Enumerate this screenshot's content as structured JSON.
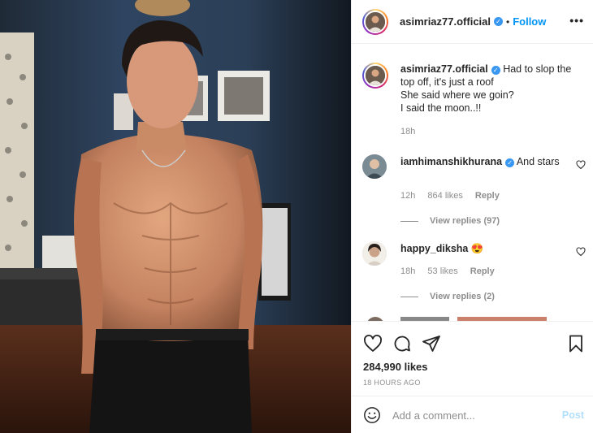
{
  "post": {
    "username": "asimriaz77.official",
    "verified": true,
    "follow_label": "Follow",
    "separator": "•",
    "more_label": "•••",
    "photo_alt": "Shirtless man posing in dim room with framed pictures on blue wall"
  },
  "caption": {
    "username": "asimriaz77.official",
    "lines": [
      "Had to slop the top off, it's just a roof",
      "She said where we goin?",
      "I said the moon..!!"
    ],
    "text": "Had to slop the top off, it's just a roof",
    "line2": "She said where we goin?",
    "line3": "I said the moon..!!",
    "time": "18h"
  },
  "comments": [
    {
      "username": "iamhimanshikhurana",
      "verified": true,
      "text": "And stars",
      "time": "12h",
      "likes": "864 likes",
      "reply_label": "Reply",
      "view_replies": "View replies (97)"
    },
    {
      "username": "happy_diksha",
      "verified": false,
      "text": "😍",
      "time": "18h",
      "likes": "53 likes",
      "reply_label": "Reply",
      "view_replies": "View replies (2)"
    }
  ],
  "actions": {
    "likes": "284,990 likes",
    "posted_ago": "18 HOURS AGO"
  },
  "composer": {
    "placeholder": "Add a comment...",
    "post_label": "Post"
  },
  "colors": {
    "link_blue": "#0095f6",
    "verified_blue": "#3897f0",
    "muted": "#8e8e8e",
    "post_disabled": "#b2dffc"
  }
}
